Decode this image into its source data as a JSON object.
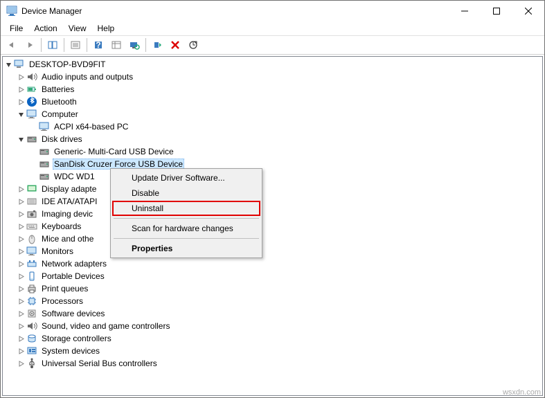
{
  "title": "Device Manager",
  "menu": {
    "file": "File",
    "action": "Action",
    "view": "View",
    "help": "Help"
  },
  "tree": {
    "root": "DESKTOP-BVD9FIT",
    "items": [
      {
        "label": "Audio inputs and outputs",
        "icon": "audio",
        "exp": ">"
      },
      {
        "label": "Batteries",
        "icon": "battery",
        "exp": ">"
      },
      {
        "label": "Bluetooth",
        "icon": "bluetooth",
        "exp": ">"
      },
      {
        "label": "Computer",
        "icon": "monitor",
        "exp": "v",
        "children": [
          {
            "label": "ACPI x64-based PC",
            "icon": "monitor"
          }
        ]
      },
      {
        "label": "Disk drives",
        "icon": "disk",
        "exp": "v",
        "children": [
          {
            "label": "Generic- Multi-Card USB Device",
            "icon": "disk"
          },
          {
            "label": "SanDisk Cruzer Force USB Device",
            "icon": "disk",
            "selected": true
          },
          {
            "label": "WDC WD1",
            "icon": "disk",
            "truncated": true
          }
        ]
      },
      {
        "label": "Display adapte",
        "icon": "display",
        "exp": ">",
        "truncated": true
      },
      {
        "label": "IDE ATA/ATAPI",
        "icon": "ide",
        "exp": ">",
        "truncated": true
      },
      {
        "label": "Imaging devic",
        "icon": "imaging",
        "exp": ">",
        "truncated": true
      },
      {
        "label": "Keyboards",
        "icon": "keyboard",
        "exp": ">"
      },
      {
        "label": "Mice and othe",
        "icon": "mouse",
        "exp": ">",
        "truncated": true
      },
      {
        "label": "Monitors",
        "icon": "monitor",
        "exp": ">"
      },
      {
        "label": "Network adapters",
        "icon": "network",
        "exp": ">"
      },
      {
        "label": "Portable Devices",
        "icon": "portable",
        "exp": ">"
      },
      {
        "label": "Print queues",
        "icon": "printer",
        "exp": ">"
      },
      {
        "label": "Processors",
        "icon": "cpu",
        "exp": ">"
      },
      {
        "label": "Software devices",
        "icon": "software",
        "exp": ">"
      },
      {
        "label": "Sound, video and game controllers",
        "icon": "audio",
        "exp": ">"
      },
      {
        "label": "Storage controllers",
        "icon": "storage",
        "exp": ">"
      },
      {
        "label": "System devices",
        "icon": "system",
        "exp": ">"
      },
      {
        "label": "Universal Serial Bus controllers",
        "icon": "usb",
        "exp": ">"
      }
    ]
  },
  "context_menu": {
    "update": "Update Driver Software...",
    "disable": "Disable",
    "uninstall": "Uninstall",
    "scan": "Scan for hardware changes",
    "properties": "Properties"
  },
  "watermark": "wsxdn.com"
}
